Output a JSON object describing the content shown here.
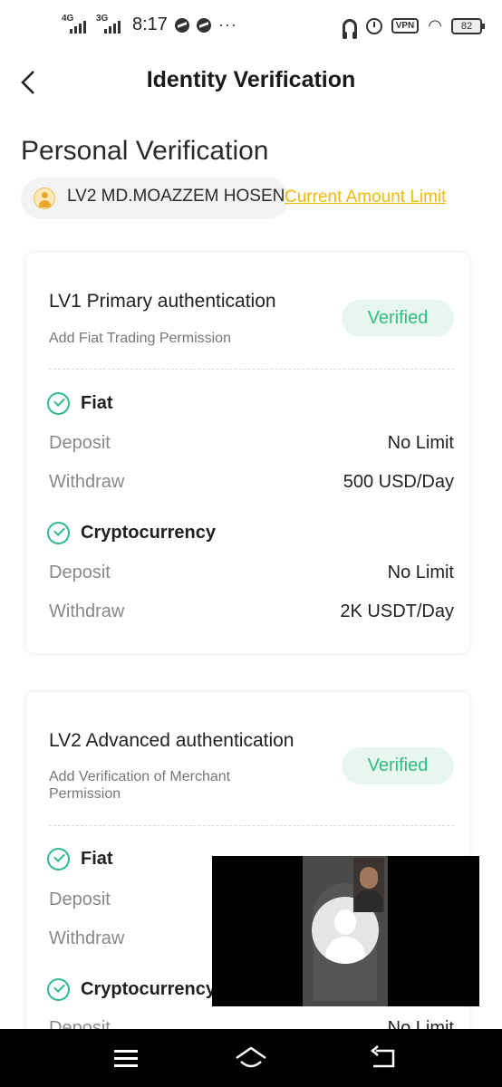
{
  "status_bar": {
    "network_1": "4G",
    "network_2": "3G",
    "time": "8:17",
    "more": "···",
    "vpn": "VPN",
    "battery": "82"
  },
  "header": {
    "title": "Identity Verification"
  },
  "section_title": "Personal Verification",
  "user": {
    "name": "LV2 MD.MOAZZEM HOSEN",
    "amount_limit_link": "Current Amount Limit"
  },
  "cards": [
    {
      "title": "LV1 Primary authentication",
      "subtitle": "Add Fiat Trading Permission",
      "status": "Verified",
      "groups": [
        {
          "name": "Fiat",
          "rows": [
            {
              "label": "Deposit",
              "value": "No Limit"
            },
            {
              "label": "Withdraw",
              "value": "500 USD/Day"
            }
          ]
        },
        {
          "name": "Cryptocurrency",
          "rows": [
            {
              "label": "Deposit",
              "value": "No Limit"
            },
            {
              "label": "Withdraw",
              "value": "2K USDT/Day"
            }
          ]
        }
      ]
    },
    {
      "title": "LV2 Advanced authentication",
      "subtitle": "Add Verification of Merchant Permission",
      "status": "Verified",
      "groups": [
        {
          "name": "Fiat",
          "rows": [
            {
              "label": "Deposit",
              "value": ""
            },
            {
              "label": "Withdraw",
              "value": ""
            }
          ]
        },
        {
          "name": "Cryptocurrency",
          "rows": [
            {
              "label": "Deposit",
              "value": "No Limit"
            }
          ]
        }
      ]
    }
  ],
  "colors": {
    "accent_green": "#2ebd85",
    "link_yellow": "#f0b90b",
    "badge_bg": "#e7f7f0"
  }
}
